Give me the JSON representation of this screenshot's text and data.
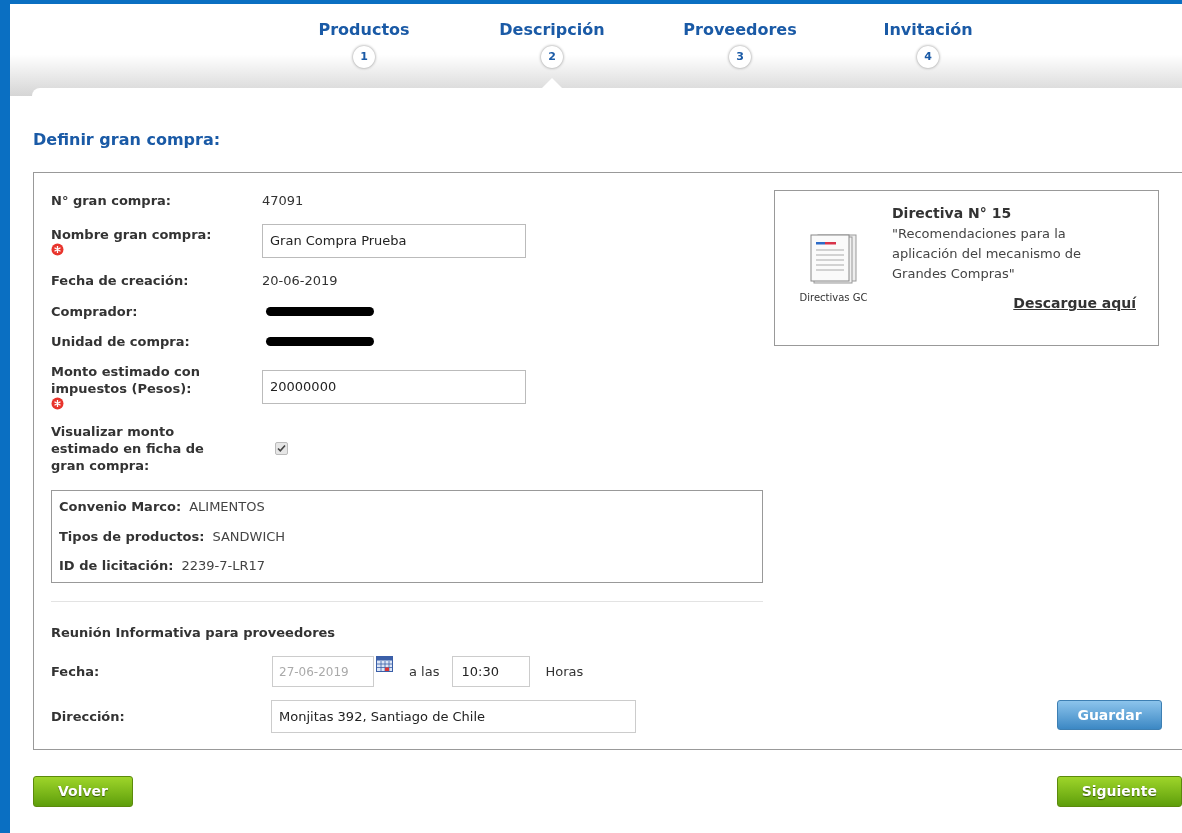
{
  "steps": [
    {
      "label": "Productos",
      "number": "1",
      "selected": false
    },
    {
      "label": "Descripción",
      "number": "2",
      "selected": true
    },
    {
      "label": "Proveedores",
      "number": "3",
      "selected": false
    },
    {
      "label": "Invitación",
      "number": "4",
      "selected": false
    }
  ],
  "section_title": "Definir gran compra:",
  "fields": [
    {
      "kind": "text",
      "label": "N° gran compra:",
      "value": "47091",
      "required": false
    },
    {
      "kind": "input",
      "label": "Nombre gran compra:",
      "value": "Gran Compra Prueba",
      "required": true
    },
    {
      "kind": "text",
      "label": "Fecha de creación:",
      "value": "20-06-2019",
      "required": false
    },
    {
      "kind": "redacted",
      "label": "Comprador:",
      "required": false
    },
    {
      "kind": "redacted",
      "label": "Unidad de compra:",
      "required": false
    },
    {
      "kind": "input",
      "label": "Monto estimado con impuestos (Pesos):",
      "value": "20000000",
      "required": true
    },
    {
      "kind": "checkbox",
      "label": "Visualizar monto estimado en ficha de gran compra:",
      "checked": true,
      "required": false
    }
  ],
  "framework": [
    {
      "label": "Convenio Marco:",
      "value": "ALIMENTOS"
    },
    {
      "label": "Tipos de productos:",
      "value": "SANDWICH"
    },
    {
      "label": "ID de licitación:",
      "value": "2239-7-LR17"
    }
  ],
  "meeting": {
    "title": "Reunión Informativa para proveedores",
    "date": {
      "label": "Fecha:",
      "value": "27-06-2019",
      "disabled": true,
      "connector": "a las",
      "time": "10:30",
      "unit": "Horas"
    },
    "address": {
      "label": "Dirección:",
      "value": "Monjitas 392, Santiago de Chile"
    }
  },
  "directive": {
    "icon_caption": "Directivas GC",
    "title": "Directiva N° 15",
    "description": "\"Recomendaciones para la aplicación del mecanismo de Grandes Compras\"",
    "link": "Descargue aquí"
  },
  "save_button": "Guardar",
  "back_button": "Volver",
  "next_button": "Siguiente"
}
